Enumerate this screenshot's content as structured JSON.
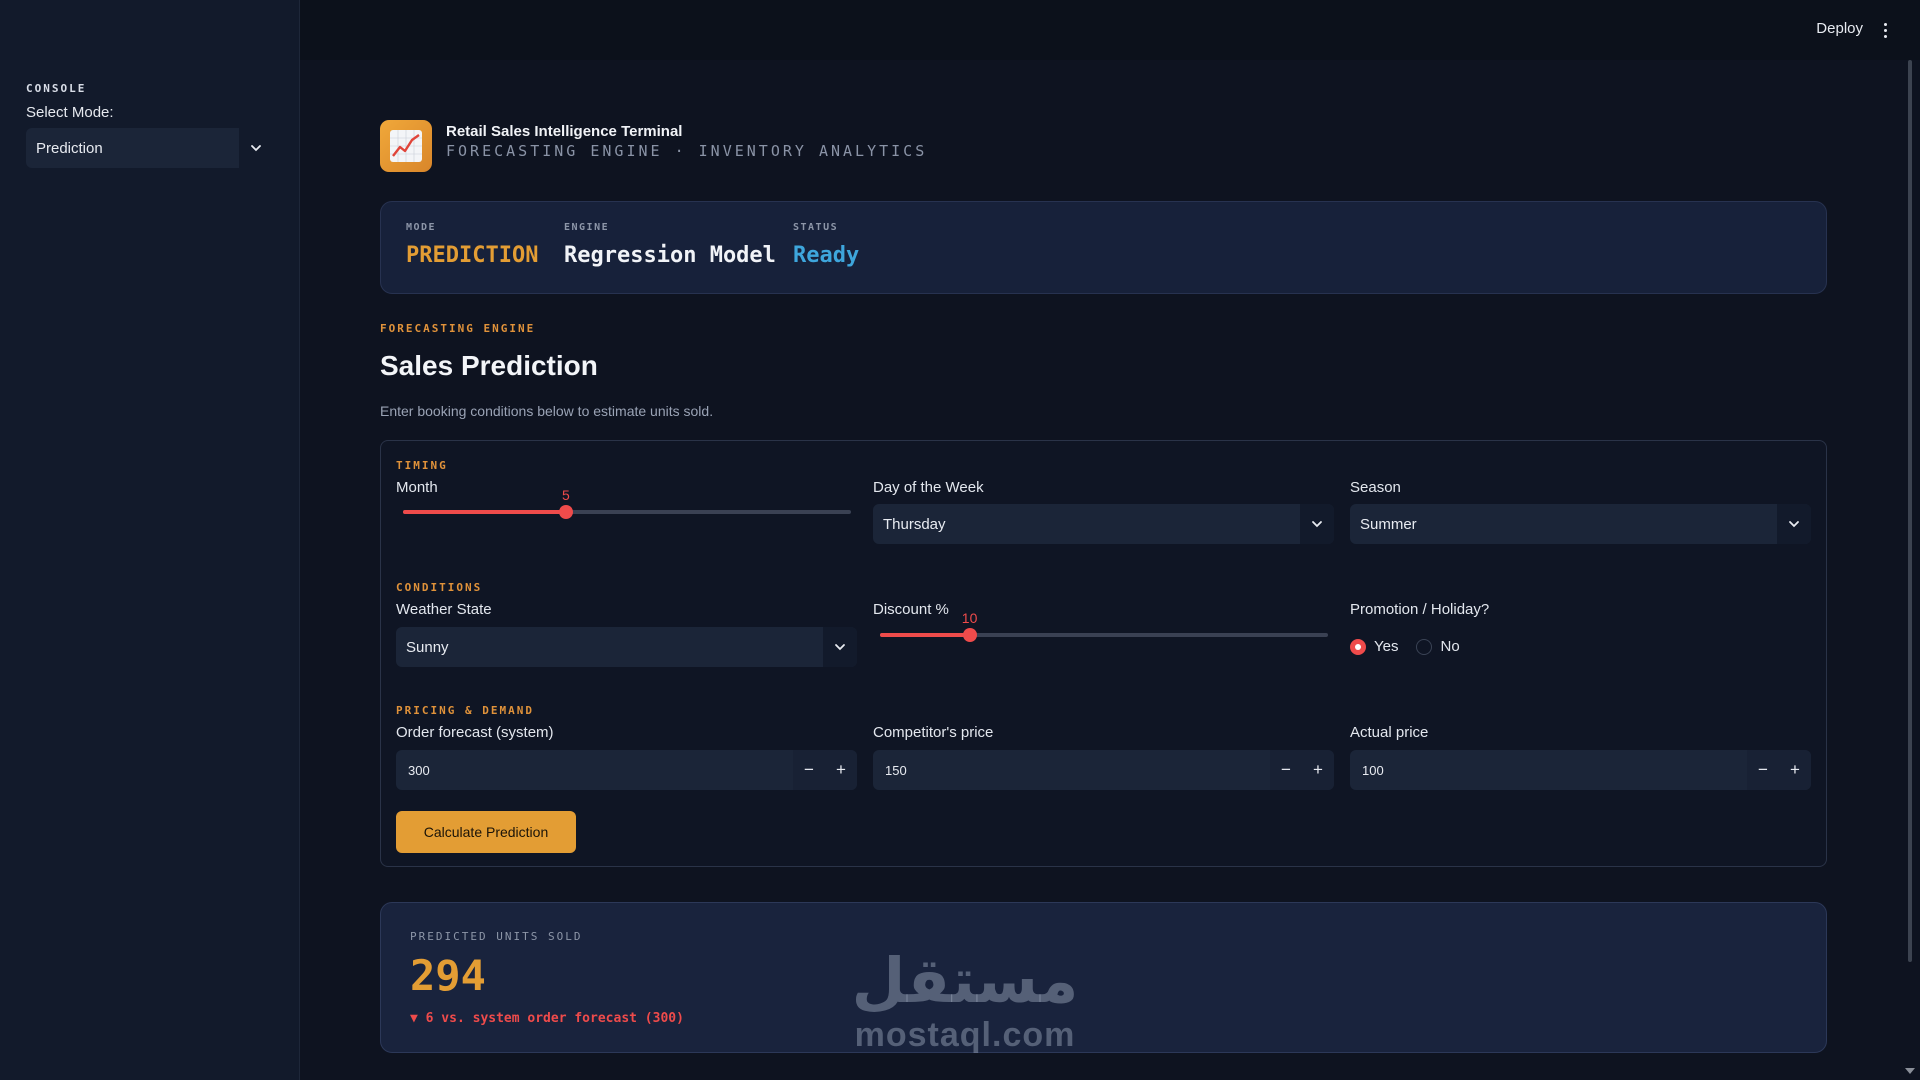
{
  "sidebar": {
    "console_label": "CONSOLE",
    "select_label": "Select Mode:",
    "mode_value": "Prediction"
  },
  "topbar": {
    "deploy_label": "Deploy"
  },
  "header": {
    "title": "Retail Sales Intelligence Terminal",
    "subtitle": "FORECASTING ENGINE · INVENTORY ANALYTICS",
    "icon": "chart-increasing-icon"
  },
  "status": {
    "mode_label": "MODE",
    "mode_value": "PREDICTION",
    "engine_label": "ENGINE",
    "engine_value": "Regression Model",
    "status_label": "STATUS",
    "status_value": "Ready",
    "colors": {
      "mode": "#e39d34",
      "engine": "#f1f3f7",
      "status": "#3ea6dc"
    }
  },
  "page": {
    "kicker": "FORECASTING ENGINE",
    "title": "Sales Prediction",
    "description": "Enter booking conditions below to estimate units sold."
  },
  "form": {
    "timing_label": "TIMING",
    "month_label": "Month",
    "month_value": "5",
    "month_min": 1,
    "month_max": 12,
    "day_label": "Day of the Week",
    "day_value": "Thursday",
    "season_label": "Season",
    "season_value": "Summer",
    "conditions_label": "CONDITIONS",
    "weather_label": "Weather State",
    "weather_value": "Sunny",
    "discount_label": "Discount %",
    "discount_value": "10",
    "discount_min": 0,
    "discount_max": 50,
    "promo_label": "Promotion / Holiday?",
    "promo_yes": "Yes",
    "promo_no": "No",
    "promo_selected": "Yes",
    "pricing_label": "PRICING & DEMAND",
    "order_label": "Order forecast (system)",
    "order_value": "300",
    "competitor_label": "Competitor's price",
    "competitor_value": "150",
    "actual_label": "Actual price",
    "actual_value": "100",
    "minus": "−",
    "plus": "+",
    "calculate_label": "Calculate Prediction"
  },
  "result": {
    "label": "PREDICTED UNITS SOLD",
    "value": "294",
    "delta": "▼ 6 vs. system order forecast (300)"
  },
  "watermark": {
    "arabic": "مستقل",
    "latin": "mostaql.com"
  },
  "accent": "#e39d34",
  "danger": "#ef4b4b"
}
